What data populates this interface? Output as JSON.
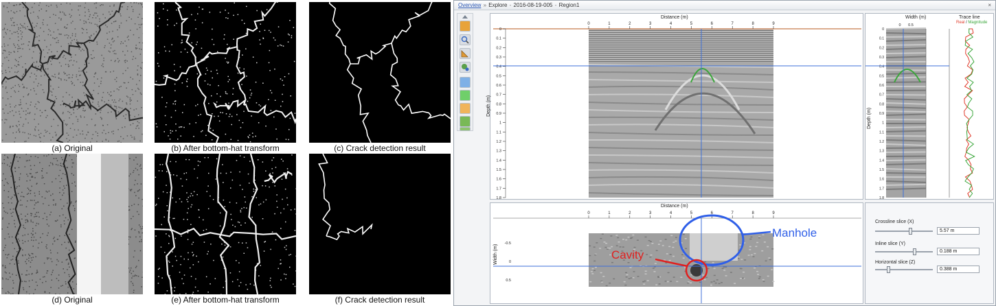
{
  "crack_panel": {
    "captions": {
      "a": "(a) Original",
      "b": "(b) After bottom-hat transform",
      "c": "(c) Crack detection result",
      "d": "(d) Original",
      "e": "(e) After bottom-hat transform",
      "f": "(f) Crack detection result"
    }
  },
  "app": {
    "breadcrumb": {
      "overview": "Overview",
      "separator": "»",
      "explore": "Explore",
      "dash": "-",
      "dataset": "2016-08-19-005",
      "region": "Region1"
    },
    "close_label": "×",
    "toolbar_icons": [
      "select-icon",
      "zoom-icon",
      "measure-icon",
      "pick-icon",
      "view-blue-icon",
      "view-green-icon",
      "view-orange-icon",
      "layer-green-icon",
      "layer-list-icon"
    ],
    "main_view": {
      "x_title": "Distance (m)",
      "y_title": "Depth (m)",
      "x_ticks": [
        "0",
        "1",
        "2",
        "3",
        "4",
        "5",
        "6",
        "7",
        "8",
        "9"
      ],
      "y_ticks": [
        "0",
        "0.1",
        "0.2",
        "0.3",
        "0.4",
        "0.5",
        "0.6",
        "0.7",
        "0.8",
        "0.9",
        "1",
        "1.1",
        "1.2",
        "1.3",
        "1.4",
        "1.5",
        "1.6",
        "1.7",
        "1.8"
      ]
    },
    "slice_view": {
      "x_title": "Distance (m)",
      "y_title": "Width (m)",
      "x_ticks": [
        "0",
        "1",
        "2",
        "3",
        "4",
        "5",
        "6",
        "7",
        "8",
        "9"
      ],
      "y_ticks": [
        "-0.5",
        "0",
        "0.5"
      ],
      "annotations": {
        "manhole": "Manhole",
        "cavity": "Cavity"
      },
      "annotation_colors": {
        "manhole": "#2f5fe8",
        "cavity": "#e0201f"
      }
    },
    "trace_view": {
      "width_title": "Width (m)",
      "width_ticks": [
        "0",
        "0.5"
      ],
      "y_title": "Depth (m)",
      "trace_title": "Trace line",
      "legend_real": "Real",
      "legend_sep": "/",
      "legend_magnitude": "Magnitude",
      "legend_colors": {
        "real": "#e03a2a",
        "magnitude": "#3aa63a"
      }
    },
    "controls": {
      "crossline": {
        "label": "Crossline slice (X)",
        "value": "5.57 m",
        "level": 0.62
      },
      "inline": {
        "label": "Inline slice (Y)",
        "value": "0.188 m",
        "level": 0.7
      },
      "horizontal": {
        "label": "Horizontal slice (Z)",
        "value": "0.388 m",
        "level": 0.21
      }
    },
    "crosshair_color": "#3d6fd8"
  }
}
